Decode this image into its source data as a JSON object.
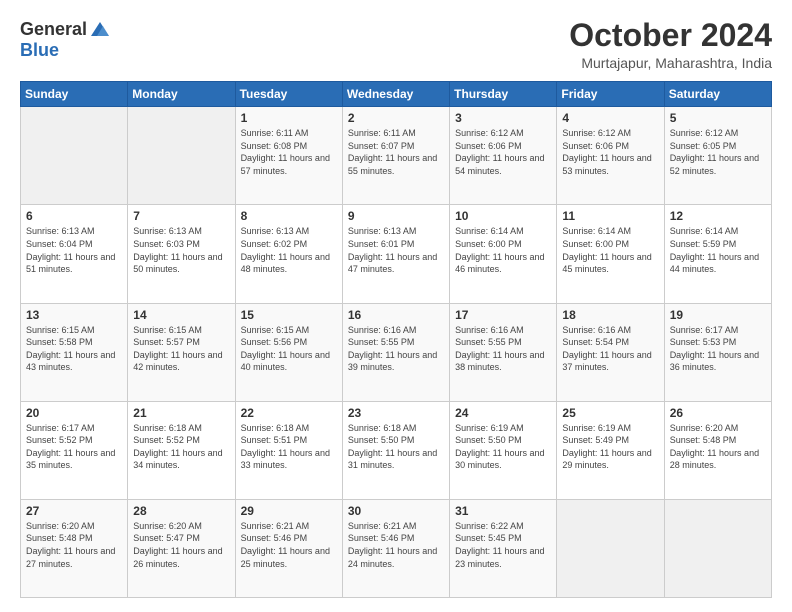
{
  "header": {
    "logo_line1": "General",
    "logo_line2": "Blue",
    "month": "October 2024",
    "location": "Murtajapur, Maharashtra, India"
  },
  "weekdays": [
    "Sunday",
    "Monday",
    "Tuesday",
    "Wednesday",
    "Thursday",
    "Friday",
    "Saturday"
  ],
  "weeks": [
    [
      {
        "day": "",
        "info": ""
      },
      {
        "day": "",
        "info": ""
      },
      {
        "day": "1",
        "info": "Sunrise: 6:11 AM\nSunset: 6:08 PM\nDaylight: 11 hours and 57 minutes."
      },
      {
        "day": "2",
        "info": "Sunrise: 6:11 AM\nSunset: 6:07 PM\nDaylight: 11 hours and 55 minutes."
      },
      {
        "day": "3",
        "info": "Sunrise: 6:12 AM\nSunset: 6:06 PM\nDaylight: 11 hours and 54 minutes."
      },
      {
        "day": "4",
        "info": "Sunrise: 6:12 AM\nSunset: 6:06 PM\nDaylight: 11 hours and 53 minutes."
      },
      {
        "day": "5",
        "info": "Sunrise: 6:12 AM\nSunset: 6:05 PM\nDaylight: 11 hours and 52 minutes."
      }
    ],
    [
      {
        "day": "6",
        "info": "Sunrise: 6:13 AM\nSunset: 6:04 PM\nDaylight: 11 hours and 51 minutes."
      },
      {
        "day": "7",
        "info": "Sunrise: 6:13 AM\nSunset: 6:03 PM\nDaylight: 11 hours and 50 minutes."
      },
      {
        "day": "8",
        "info": "Sunrise: 6:13 AM\nSunset: 6:02 PM\nDaylight: 11 hours and 48 minutes."
      },
      {
        "day": "9",
        "info": "Sunrise: 6:13 AM\nSunset: 6:01 PM\nDaylight: 11 hours and 47 minutes."
      },
      {
        "day": "10",
        "info": "Sunrise: 6:14 AM\nSunset: 6:00 PM\nDaylight: 11 hours and 46 minutes."
      },
      {
        "day": "11",
        "info": "Sunrise: 6:14 AM\nSunset: 6:00 PM\nDaylight: 11 hours and 45 minutes."
      },
      {
        "day": "12",
        "info": "Sunrise: 6:14 AM\nSunset: 5:59 PM\nDaylight: 11 hours and 44 minutes."
      }
    ],
    [
      {
        "day": "13",
        "info": "Sunrise: 6:15 AM\nSunset: 5:58 PM\nDaylight: 11 hours and 43 minutes."
      },
      {
        "day": "14",
        "info": "Sunrise: 6:15 AM\nSunset: 5:57 PM\nDaylight: 11 hours and 42 minutes."
      },
      {
        "day": "15",
        "info": "Sunrise: 6:15 AM\nSunset: 5:56 PM\nDaylight: 11 hours and 40 minutes."
      },
      {
        "day": "16",
        "info": "Sunrise: 6:16 AM\nSunset: 5:55 PM\nDaylight: 11 hours and 39 minutes."
      },
      {
        "day": "17",
        "info": "Sunrise: 6:16 AM\nSunset: 5:55 PM\nDaylight: 11 hours and 38 minutes."
      },
      {
        "day": "18",
        "info": "Sunrise: 6:16 AM\nSunset: 5:54 PM\nDaylight: 11 hours and 37 minutes."
      },
      {
        "day": "19",
        "info": "Sunrise: 6:17 AM\nSunset: 5:53 PM\nDaylight: 11 hours and 36 minutes."
      }
    ],
    [
      {
        "day": "20",
        "info": "Sunrise: 6:17 AM\nSunset: 5:52 PM\nDaylight: 11 hours and 35 minutes."
      },
      {
        "day": "21",
        "info": "Sunrise: 6:18 AM\nSunset: 5:52 PM\nDaylight: 11 hours and 34 minutes."
      },
      {
        "day": "22",
        "info": "Sunrise: 6:18 AM\nSunset: 5:51 PM\nDaylight: 11 hours and 33 minutes."
      },
      {
        "day": "23",
        "info": "Sunrise: 6:18 AM\nSunset: 5:50 PM\nDaylight: 11 hours and 31 minutes."
      },
      {
        "day": "24",
        "info": "Sunrise: 6:19 AM\nSunset: 5:50 PM\nDaylight: 11 hours and 30 minutes."
      },
      {
        "day": "25",
        "info": "Sunrise: 6:19 AM\nSunset: 5:49 PM\nDaylight: 11 hours and 29 minutes."
      },
      {
        "day": "26",
        "info": "Sunrise: 6:20 AM\nSunset: 5:48 PM\nDaylight: 11 hours and 28 minutes."
      }
    ],
    [
      {
        "day": "27",
        "info": "Sunrise: 6:20 AM\nSunset: 5:48 PM\nDaylight: 11 hours and 27 minutes."
      },
      {
        "day": "28",
        "info": "Sunrise: 6:20 AM\nSunset: 5:47 PM\nDaylight: 11 hours and 26 minutes."
      },
      {
        "day": "29",
        "info": "Sunrise: 6:21 AM\nSunset: 5:46 PM\nDaylight: 11 hours and 25 minutes."
      },
      {
        "day": "30",
        "info": "Sunrise: 6:21 AM\nSunset: 5:46 PM\nDaylight: 11 hours and 24 minutes."
      },
      {
        "day": "31",
        "info": "Sunrise: 6:22 AM\nSunset: 5:45 PM\nDaylight: 11 hours and 23 minutes."
      },
      {
        "day": "",
        "info": ""
      },
      {
        "day": "",
        "info": ""
      }
    ]
  ]
}
